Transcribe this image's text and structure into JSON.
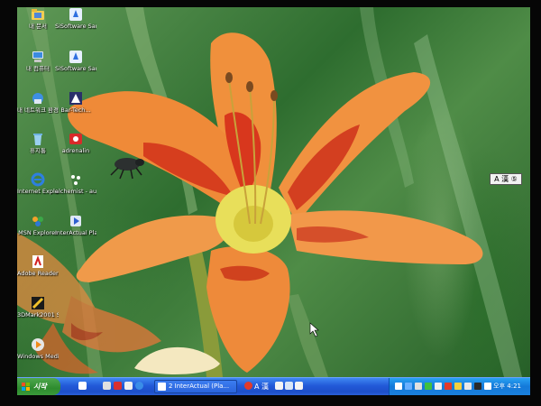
{
  "desktop": {
    "icons": [
      {
        "id": "my-documents",
        "label": "내 문서",
        "icon": "folder-documents-icon"
      },
      {
        "id": "sisoftware-1",
        "label": "SiSoftware Sandra ...",
        "icon": "sandra-icon"
      },
      {
        "id": "my-computer",
        "label": "내 컴퓨터",
        "icon": "computer-icon"
      },
      {
        "id": "sisoftware-2",
        "label": "SiSoftware Sandra ...",
        "icon": "sandra-icon"
      },
      {
        "id": "network-places",
        "label": "내 네트워크 환경",
        "icon": "network-icon"
      },
      {
        "id": "bar-tech",
        "label": "Bar-Tech...",
        "icon": "app-icon"
      },
      {
        "id": "recycle-bin",
        "label": "휴지통",
        "icon": "recycle-bin-icon"
      },
      {
        "id": "adrenalin",
        "label": "adrenalin",
        "icon": "adrenalin-icon"
      },
      {
        "id": "internet-explorer",
        "label": "Internet Explorer",
        "icon": "internet-explorer-icon"
      },
      {
        "id": "alchemist",
        "label": "alchemist - audioalin...",
        "icon": "alchemist-icon"
      },
      {
        "id": "msn-explorer",
        "label": "MSN Explorer",
        "icon": "msn-icon"
      },
      {
        "id": "interactual-player",
        "label": "InterActual Player",
        "icon": "interactual-icon"
      },
      {
        "id": "adobe-reader",
        "label": "Adobe Reader 6.0",
        "icon": "adobe-reader-icon"
      },
      {
        "id": "3dmark",
        "label": "3DMark2001 SE",
        "icon": "3dmark-icon"
      },
      {
        "id": "media-player",
        "label": "Windows Media ...",
        "icon": "media-player-icon"
      }
    ],
    "ime_toolbar": "A 漢 ⑤"
  },
  "taskbar": {
    "start_label": "시작",
    "task_button": "2 InterActual (Pla...",
    "language": "A 漢",
    "clock": "오후 4:21"
  },
  "colors": {
    "taskbar": "#2259d8",
    "tray": "#1479d9",
    "start": "#2e8b2e",
    "petal_outer": "#f0903c",
    "petal_center": "#d42818",
    "throat": "#e8df5a"
  }
}
